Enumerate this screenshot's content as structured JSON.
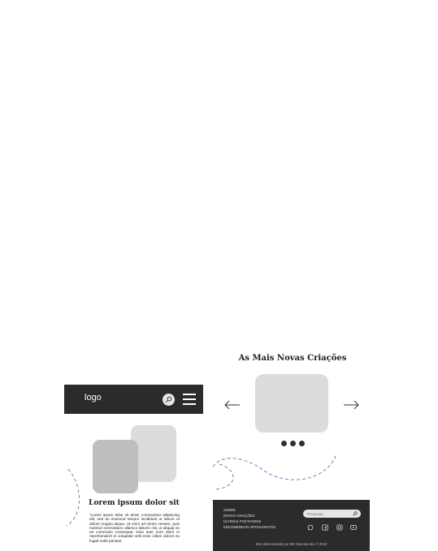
{
  "header": {
    "logo_text": "logo",
    "search_icon": "search-icon",
    "menu_icon": "hamburger-menu-icon"
  },
  "hero": {
    "title": "Lorem ipsum dolor sit",
    "text": "\"Lorem ipsum dolor sit amet, consectetur adipiscing elit, sed do eiusmod tempor incididunt ut labore et dolore magna aliqua. Ut enim ad minim veniam, quis nostrud exercitation ullamco laboris nisi ut aliquip ex ea commodo consequat. Duis aute irure dolor in reprehenderit in voluptate velit esse cillum dolore eu fugiat nulla pariatur."
  },
  "carousel": {
    "title": "As Mais Novas Criações",
    "prev_icon": "arrow-left-icon",
    "next_icon": "arrow-right-icon",
    "dots": 3
  },
  "footer": {
    "links": [
      "SOBRE",
      "NOVAS CRIAÇÕES",
      "ÚLTIMAS POSTAGENS",
      "ENCOMENDAR ARTESANATOS"
    ],
    "search_placeholder": "Pesquisar",
    "social_icons": [
      "whatsapp-icon",
      "facebook-icon",
      "instagram-icon",
      "youtube-icon"
    ],
    "credits": "Site desenvolvido por Mk Sancias.dev © 2024"
  },
  "colors": {
    "dark": "#2b2b2b",
    "placeholder_light": "#dcdcdc",
    "placeholder_mid": "#bfbdbf",
    "dashed_line": "#7d7ab8"
  }
}
